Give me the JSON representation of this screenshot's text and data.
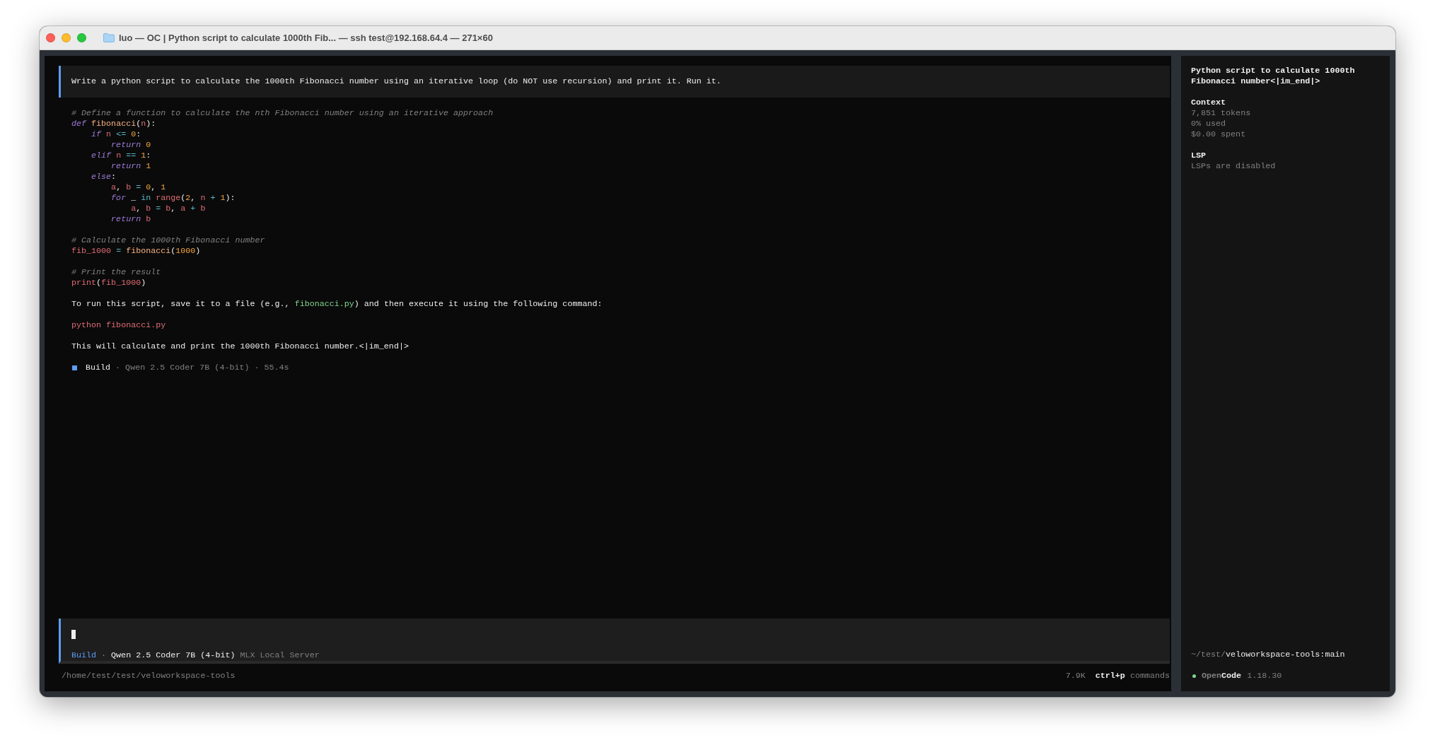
{
  "window": {
    "title": "luo — OC | Python script to calculate 1000th Fib... — ssh test@192.168.64.4 — 271×60"
  },
  "prompt": "Write a python script to calculate the 1000th Fibonacci number using an iterative loop (do NOT use recursion) and print it. Run it.",
  "response": [
    {
      "kind": "code",
      "lines": [
        [
          {
            "kind": "comment",
            "text": "# Define a function to calculate the nth Fibonacci number using an iterative approach"
          }
        ],
        [
          {
            "kind": "keyword",
            "text": "def "
          },
          {
            "kind": "function",
            "text": "fibonacci"
          },
          {
            "kind": "punct",
            "text": "("
          },
          {
            "kind": "variable",
            "text": "n"
          },
          {
            "kind": "punct",
            "text": "):"
          }
        ],
        [
          {
            "kind": "keyword",
            "text": "    if "
          },
          {
            "kind": "variable",
            "text": "n "
          },
          {
            "kind": "operator",
            "text": "<= "
          },
          {
            "kind": "number",
            "text": "0"
          },
          {
            "kind": "punct",
            "text": ":"
          }
        ],
        [
          {
            "kind": "keyword",
            "text": "        return "
          },
          {
            "kind": "number",
            "text": "0"
          }
        ],
        [
          {
            "kind": "keyword",
            "text": "    elif "
          },
          {
            "kind": "variable",
            "text": "n "
          },
          {
            "kind": "operator",
            "text": "== "
          },
          {
            "kind": "number",
            "text": "1"
          },
          {
            "kind": "punct",
            "text": ":"
          }
        ],
        [
          {
            "kind": "keyword",
            "text": "        return "
          },
          {
            "kind": "number",
            "text": "1"
          }
        ],
        [
          {
            "kind": "keyword",
            "text": "    else"
          },
          {
            "kind": "punct",
            "text": ":"
          }
        ],
        [
          {
            "kind": "variable",
            "text": "        a"
          },
          {
            "kind": "punct",
            "text": ", "
          },
          {
            "kind": "variable",
            "text": "b "
          },
          {
            "kind": "operator",
            "text": "= "
          },
          {
            "kind": "number",
            "text": "0"
          },
          {
            "kind": "punct",
            "text": ", "
          },
          {
            "kind": "number",
            "text": "1"
          }
        ],
        [
          {
            "kind": "keyword",
            "text": "        for "
          },
          {
            "kind": "punct",
            "text": "_ "
          },
          {
            "kind": "operator",
            "text": "in "
          },
          {
            "kind": "builtin",
            "text": "range"
          },
          {
            "kind": "punct",
            "text": "("
          },
          {
            "kind": "number",
            "text": "2"
          },
          {
            "kind": "punct",
            "text": ", "
          },
          {
            "kind": "variable",
            "text": "n "
          },
          {
            "kind": "operator",
            "text": "+ "
          },
          {
            "kind": "number",
            "text": "1"
          },
          {
            "kind": "punct",
            "text": "):"
          }
        ],
        [
          {
            "kind": "variable",
            "text": "            a"
          },
          {
            "kind": "punct",
            "text": ", "
          },
          {
            "kind": "variable",
            "text": "b "
          },
          {
            "kind": "operator",
            "text": "= "
          },
          {
            "kind": "variable",
            "text": "b"
          },
          {
            "kind": "punct",
            "text": ", "
          },
          {
            "kind": "variable",
            "text": "a "
          },
          {
            "kind": "operator",
            "text": "+ "
          },
          {
            "kind": "variable",
            "text": "b"
          }
        ],
        [
          {
            "kind": "keyword",
            "text": "        return "
          },
          {
            "kind": "variable",
            "text": "b"
          }
        ]
      ]
    },
    {
      "kind": "code",
      "lines": [
        [
          {
            "kind": "comment",
            "text": "# Calculate the 1000th Fibonacci number"
          }
        ],
        [
          {
            "kind": "variable",
            "text": "fib_1000 "
          },
          {
            "kind": "operator",
            "text": "= "
          },
          {
            "kind": "function",
            "text": "fibonacci"
          },
          {
            "kind": "punct",
            "text": "("
          },
          {
            "kind": "number",
            "text": "1000"
          },
          {
            "kind": "punct",
            "text": ")"
          }
        ]
      ]
    },
    {
      "kind": "code",
      "lines": [
        [
          {
            "kind": "comment",
            "text": "# Print the result"
          }
        ],
        [
          {
            "kind": "builtin",
            "text": "print"
          },
          {
            "kind": "punct",
            "text": "("
          },
          {
            "kind": "variable",
            "text": "fib_1000"
          },
          {
            "kind": "punct",
            "text": ")"
          }
        ]
      ]
    },
    {
      "kind": "paragraph",
      "segments": [
        {
          "kind": "plain",
          "text": "To run this script, save it to a file (e.g., "
        },
        {
          "kind": "inline_code",
          "text": "fibonacci.py"
        },
        {
          "kind": "plain",
          "text": ") and then execute it using the following command:"
        }
      ]
    },
    {
      "kind": "code",
      "lines": [
        [
          {
            "kind": "builtin",
            "text": "python fibonacci.py"
          }
        ]
      ]
    },
    {
      "kind": "paragraph",
      "segments": [
        {
          "kind": "plain",
          "text": "This will calculate and print the 1000th Fibonacci number.<|im_end|>"
        }
      ]
    }
  ],
  "run_status": {
    "agent": "Build",
    "details": "· Qwen 2.5 Coder 7B (4-bit) · 55.4s"
  },
  "input": {
    "agent": "Build",
    "separator": "·",
    "model": "Qwen 2.5 Coder 7B (4-bit)",
    "provider": "MLX Local Server"
  },
  "footer": {
    "path": "/home/test/test/veloworkspace-tools",
    "tokens": "7.9K",
    "shortcut": "ctrl+p",
    "shortcut_label": "commands"
  },
  "sidebar": {
    "title": "Python script to calculate 1000th Fibonacci number<|im_end|>",
    "sections": [
      {
        "heading": "Context",
        "lines": [
          "7,851 tokens",
          "0% used",
          "$0.00 spent"
        ]
      },
      {
        "heading": "LSP",
        "lines": [
          "LSPs are disabled"
        ]
      }
    ],
    "directory": {
      "prefix": "~/test/",
      "repo": "veloworkspace-tools:main"
    },
    "app": {
      "name_light": "Open",
      "name_bold": "Code",
      "version": "1.18.30"
    }
  }
}
